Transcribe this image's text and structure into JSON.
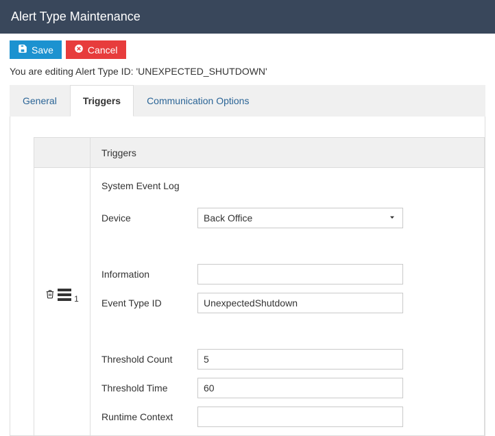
{
  "header": {
    "title": "Alert Type Maintenance"
  },
  "toolbar": {
    "save_label": "Save",
    "cancel_label": "Cancel"
  },
  "editing_msg": "You are editing Alert Type ID: 'UNEXPECTED_SHUTDOWN'",
  "tabs": [
    {
      "label": "General"
    },
    {
      "label": "Triggers"
    },
    {
      "label": "Communication Options"
    }
  ],
  "triggers_panel": {
    "column_header": "Triggers",
    "row_index": "1",
    "section_title": "System Event Log",
    "fields": {
      "device": {
        "label": "Device",
        "value": "Back Office"
      },
      "information": {
        "label": "Information",
        "value": ""
      },
      "event_type_id": {
        "label": "Event Type ID",
        "value": "UnexpectedShutdown"
      },
      "threshold_count": {
        "label": "Threshold Count",
        "value": "5"
      },
      "threshold_time": {
        "label": "Threshold Time",
        "value": "60"
      },
      "runtime_context": {
        "label": "Runtime Context",
        "value": ""
      }
    }
  }
}
